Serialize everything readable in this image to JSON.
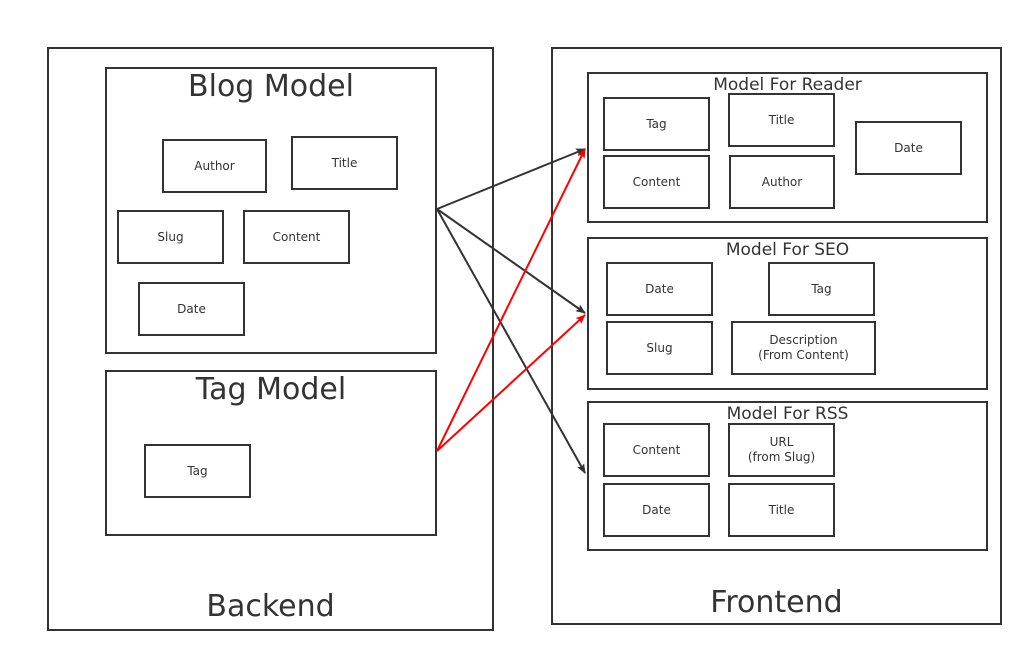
{
  "backend": {
    "label": "Backend",
    "models": {
      "blog": {
        "title": "Blog Model",
        "fields": [
          "Author",
          "Title",
          "Slug",
          "Content",
          "Date"
        ]
      },
      "tag": {
        "title": "Tag Model",
        "fields": [
          "Tag"
        ]
      }
    }
  },
  "frontend": {
    "label": "Frontend",
    "models": {
      "reader": {
        "title": "Model For Reader",
        "fields": [
          "Tag",
          "Title",
          "Date",
          "Content",
          "Author"
        ]
      },
      "seo": {
        "title": "Model For SEO",
        "fields": [
          "Date",
          "Tag",
          "Slug",
          "Description\n(From Content)"
        ]
      },
      "rss": {
        "title": "Model For RSS",
        "fields": [
          "Content",
          "URL\n(from Slug)",
          "Date",
          "Title"
        ]
      }
    }
  },
  "connections": [
    {
      "from": "Blog Model",
      "to": "Model For Reader",
      "color": "#333333"
    },
    {
      "from": "Blog Model",
      "to": "Model For SEO",
      "color": "#333333"
    },
    {
      "from": "Blog Model",
      "to": "Model For RSS",
      "color": "#333333"
    },
    {
      "from": "Tag Model",
      "to": "Model For Reader",
      "color": "#ff0000"
    },
    {
      "from": "Tag Model",
      "to": "Model For SEO",
      "color": "#ff0000"
    }
  ]
}
